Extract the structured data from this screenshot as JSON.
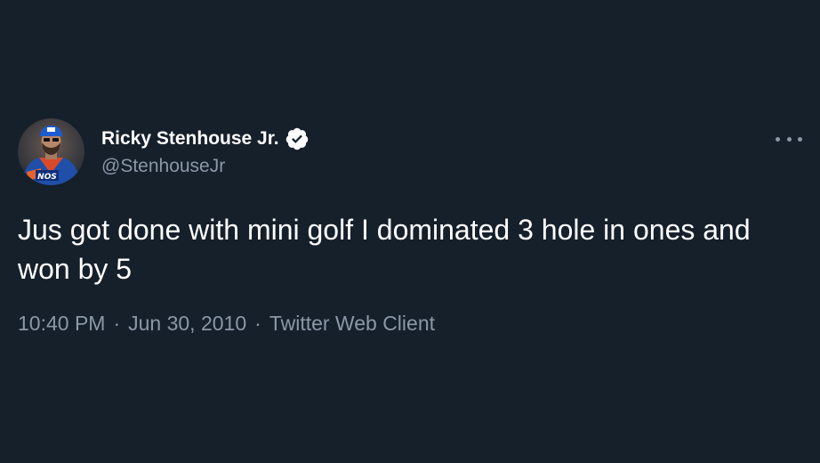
{
  "colors": {
    "background": "#15202b",
    "primary_text": "#ffffff",
    "secondary_text": "#8b98a5",
    "verified_badge": "#ffffff"
  },
  "author": {
    "display_name": "Ricky Stenhouse Jr.",
    "handle": "@StenhouseJr",
    "verified": true,
    "avatar_icon": "profile-photo-icon",
    "avatar_logo_text": "NOS"
  },
  "tweet": {
    "text": "Jus got done with mini golf I dominated 3 hole in ones and won by 5"
  },
  "meta": {
    "time": "10:40 PM",
    "separator": "·",
    "date": "Jun 30, 2010",
    "source": "Twitter Web Client"
  },
  "icons": {
    "more": "more-options-icon",
    "verified": "verified-badge-icon"
  }
}
